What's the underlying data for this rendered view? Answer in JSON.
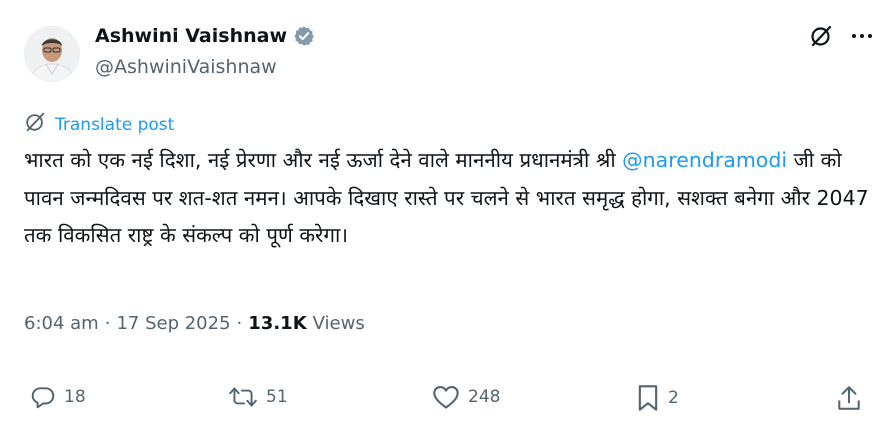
{
  "author": {
    "display_name": "Ashwini Vaishnaw",
    "handle": "@AshwiniVaishnaw",
    "verified": true
  },
  "translate": {
    "label": "Translate post"
  },
  "post": {
    "text_before": "भारत को एक नई दिशा, नई प्रेरणा और नई ऊर्जा देने वाले माननीय प्रधानमंत्री श्री ",
    "mention": "@narendramodi",
    "text_after": " जी को पावन जन्मदिवस पर शत-शत नमन। आपके दिखाए रास्ते पर चलने से भारत समृद्ध होगा, सशक्त बनेगा और 2047 तक विकसित राष्ट्र के संकल्प को पूर्ण करेगा।"
  },
  "meta": {
    "time": "6:04 am",
    "separator": "·",
    "date": "17 Sep 2025",
    "views_count": "13.1K",
    "views_label": "Views"
  },
  "actions": {
    "replies": "18",
    "reposts": "51",
    "likes": "248",
    "bookmarks": "2"
  },
  "colors": {
    "accent": "#1d9bf0",
    "muted": "#536471",
    "text": "#0f1419"
  },
  "icons": {
    "verified": "verified-badge-icon",
    "grok": "grok-icon",
    "more": "more-icon",
    "translate": "translate-icon",
    "reply": "reply-icon",
    "repost": "repost-icon",
    "like": "like-icon",
    "bookmark": "bookmark-icon",
    "share": "share-icon"
  }
}
